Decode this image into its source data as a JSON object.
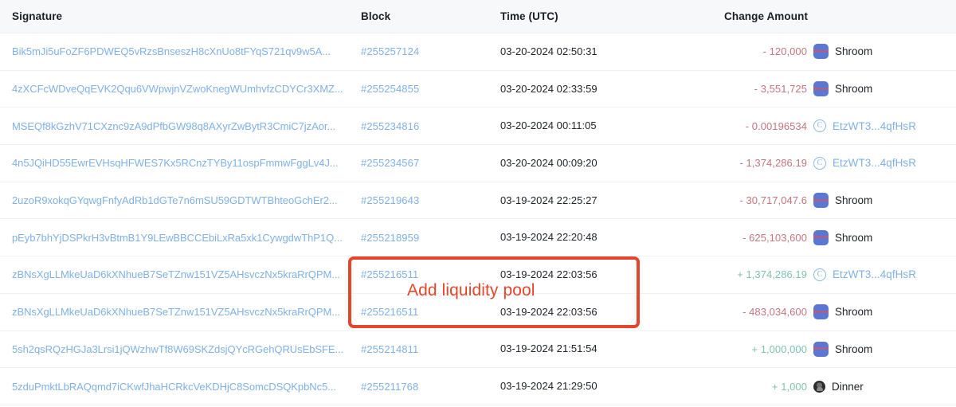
{
  "table": {
    "columns": [
      {
        "key": "signature",
        "label": "Signature"
      },
      {
        "key": "block",
        "label": "Block"
      },
      {
        "key": "time",
        "label": "Time (UTC)"
      },
      {
        "key": "amount",
        "label": "Change Amount"
      }
    ],
    "rows": [
      {
        "signature": "Bik5mJi5uFoZF6PDWEQ5vRzsBnseszH8cXnUo8tFYqS721qv9w5A...",
        "block": "#255257124",
        "time": "03-20-2024 02:50:31",
        "amount": "- 120,000",
        "amount_sign": "negative",
        "token_icon": "shroom-token-icon",
        "token_icon_text": "Shroom",
        "token": "Shroom",
        "token_is_address": false
      },
      {
        "signature": "4zXCFcWDveQqEVK2Qqu6VWpwjnVZwoKnegWUmhvfzCDYCr3XMZ...",
        "block": "#255254855",
        "time": "03-20-2024 02:33:59",
        "amount": "- 3,551,725",
        "amount_sign": "negative",
        "token_icon": "shroom-token-icon",
        "token_icon_text": "Shroom",
        "token": "Shroom",
        "token_is_address": false
      },
      {
        "signature": "MSEQf8kGzhV71CXznc9zA9dPfbGW98q8AXyrZwBytR3CmiC7jzAor...",
        "block": "#255234816",
        "time": "03-20-2024 00:11:05",
        "amount": "- 0.00196534",
        "amount_sign": "negative",
        "token_icon": "circle-c-token-icon",
        "token_icon_text": "C",
        "token": "EtzWT3...4qfHsR",
        "token_is_address": true
      },
      {
        "signature": "4n5JQiHD55EwrEVHsqHFWES7Kx5RCnzTYBy11ospFmmwFggLv4J...",
        "block": "#255234567",
        "time": "03-20-2024 00:09:20",
        "amount": "- 1,374,286.19",
        "amount_sign": "negative",
        "token_icon": "circle-c-token-icon",
        "token_icon_text": "C",
        "token": "EtzWT3...4qfHsR",
        "token_is_address": true
      },
      {
        "signature": "2uzoR9xokqGYqwgFnfyAdRb1dGTe7n6mSU59GDTWTBhteoGchEr2...",
        "block": "#255219643",
        "time": "03-19-2024 22:25:27",
        "amount": "- 30,717,047.6",
        "amount_sign": "negative",
        "token_icon": "shroom-token-icon",
        "token_icon_text": "Shroom",
        "token": "Shroom",
        "token_is_address": false
      },
      {
        "signature": "pEyb7bhYjDSPkrH3vBtmB1Y9LEwBBCCEbiLxRa5xk1CywgdwThP1Q...",
        "block": "#255218959",
        "time": "03-19-2024 22:20:48",
        "amount": "- 625,103,600",
        "amount_sign": "negative",
        "token_icon": "shroom-token-icon",
        "token_icon_text": "Shroom",
        "token": "Shroom",
        "token_is_address": false
      },
      {
        "signature": "zBNsXgLLMkeUaD6kXNhueB7SeTZnw151VZ5AHsvczNx5kraRrQPM...",
        "block": "#255216511",
        "time": "03-19-2024 22:03:56",
        "amount": "+ 1,374,286.19",
        "amount_sign": "positive",
        "token_icon": "circle-c-token-icon",
        "token_icon_text": "C",
        "token": "EtzWT3...4qfHsR",
        "token_is_address": true
      },
      {
        "signature": "zBNsXgLLMkeUaD6kXNhueB7SeTZnw151VZ5AHsvczNx5kraRrQPM...",
        "block": "#255216511",
        "time": "03-19-2024 22:03:56",
        "amount": "- 483,034,600",
        "amount_sign": "negative",
        "token_icon": "shroom-token-icon",
        "token_icon_text": "Shroom",
        "token": "Shroom",
        "token_is_address": false
      },
      {
        "signature": "5sh2qsRQzHGJa3Lrsi1jQWzhwTf8W69SKZdsjQYcRGehQRUsEbSFE...",
        "block": "#255214811",
        "time": "03-19-2024 21:51:54",
        "amount": "+ 1,000,000",
        "amount_sign": "positive",
        "token_icon": "shroom-token-icon",
        "token_icon_text": "Shroom",
        "token": "Shroom",
        "token_is_address": false
      },
      {
        "signature": "5zduPmktLbRAQqmd7iCKwfJhaHCRkcVeKDHjC8SomcDSQKpbNc5...",
        "block": "#255211768",
        "time": "03-19-2024 21:29:50",
        "amount": "+ 1,000",
        "amount_sign": "positive",
        "token_icon": "dinner-token-icon",
        "token_icon_text": "",
        "token": "Dinner",
        "token_is_address": false
      }
    ]
  },
  "annotation": {
    "label": "Add liquidity pool",
    "color": "#e5452a"
  },
  "colors": {
    "link": "#7fb1e6",
    "negative": "#c4757f",
    "positive": "#7ec3a9",
    "header_bg": "#f7f8f9",
    "text": "#20242a"
  }
}
